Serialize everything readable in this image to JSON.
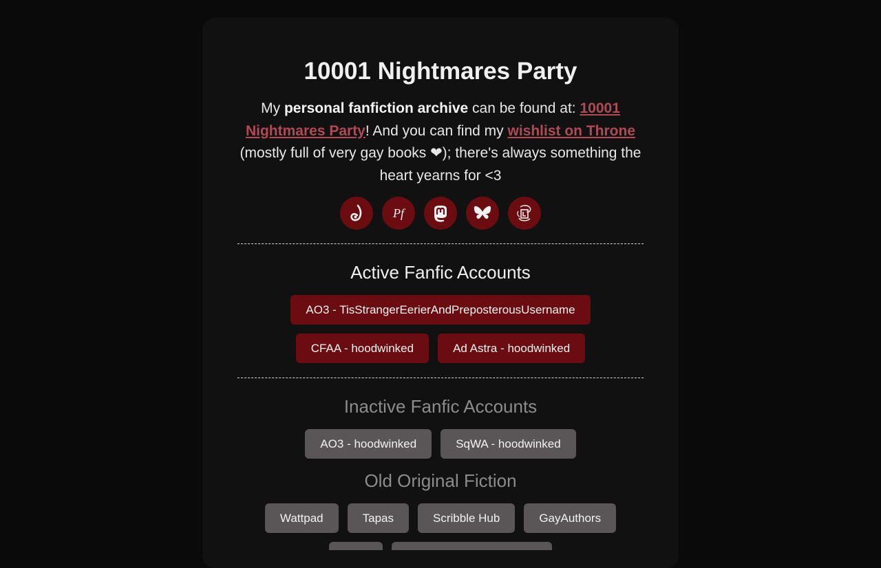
{
  "header": {
    "title": "10001 Nightmares Party"
  },
  "intro": {
    "part1": "My ",
    "bold": "personal fanfiction archive",
    "part2": " can be found at: ",
    "link1": "10001 Nightmares Party",
    "part3": "! And you can find my ",
    "link2": "wishlist on Throne",
    "part4": " (mostly full of very gay books ❤); there's always something the heart yearns for <3"
  },
  "socials": [
    {
      "icon": "dreamwidth-icon"
    },
    {
      "icon": "pillowfort-icon"
    },
    {
      "icon": "mastodon-icon"
    },
    {
      "icon": "bluesky-icon"
    },
    {
      "icon": "livejournal-icon"
    }
  ],
  "colors": {
    "accent": "#6b0d10",
    "link": "#b04a55",
    "muted_button": "#5a5556"
  },
  "active": {
    "title": "Active Fanfic Accounts",
    "accounts": [
      "AO3 - TisStrangerEerierAndPreposterousUsername",
      "CFAA - hoodwinked",
      "Ad Astra - hoodwinked"
    ]
  },
  "inactive": {
    "title": "Inactive Fanfic Accounts",
    "accounts": [
      "AO3 - hoodwinked",
      "SqWA - hoodwinked"
    ]
  },
  "original": {
    "title": "Old Original Fiction",
    "accounts": [
      "Wattpad",
      "Tapas",
      "Scribble Hub",
      "GayAuthors"
    ]
  }
}
